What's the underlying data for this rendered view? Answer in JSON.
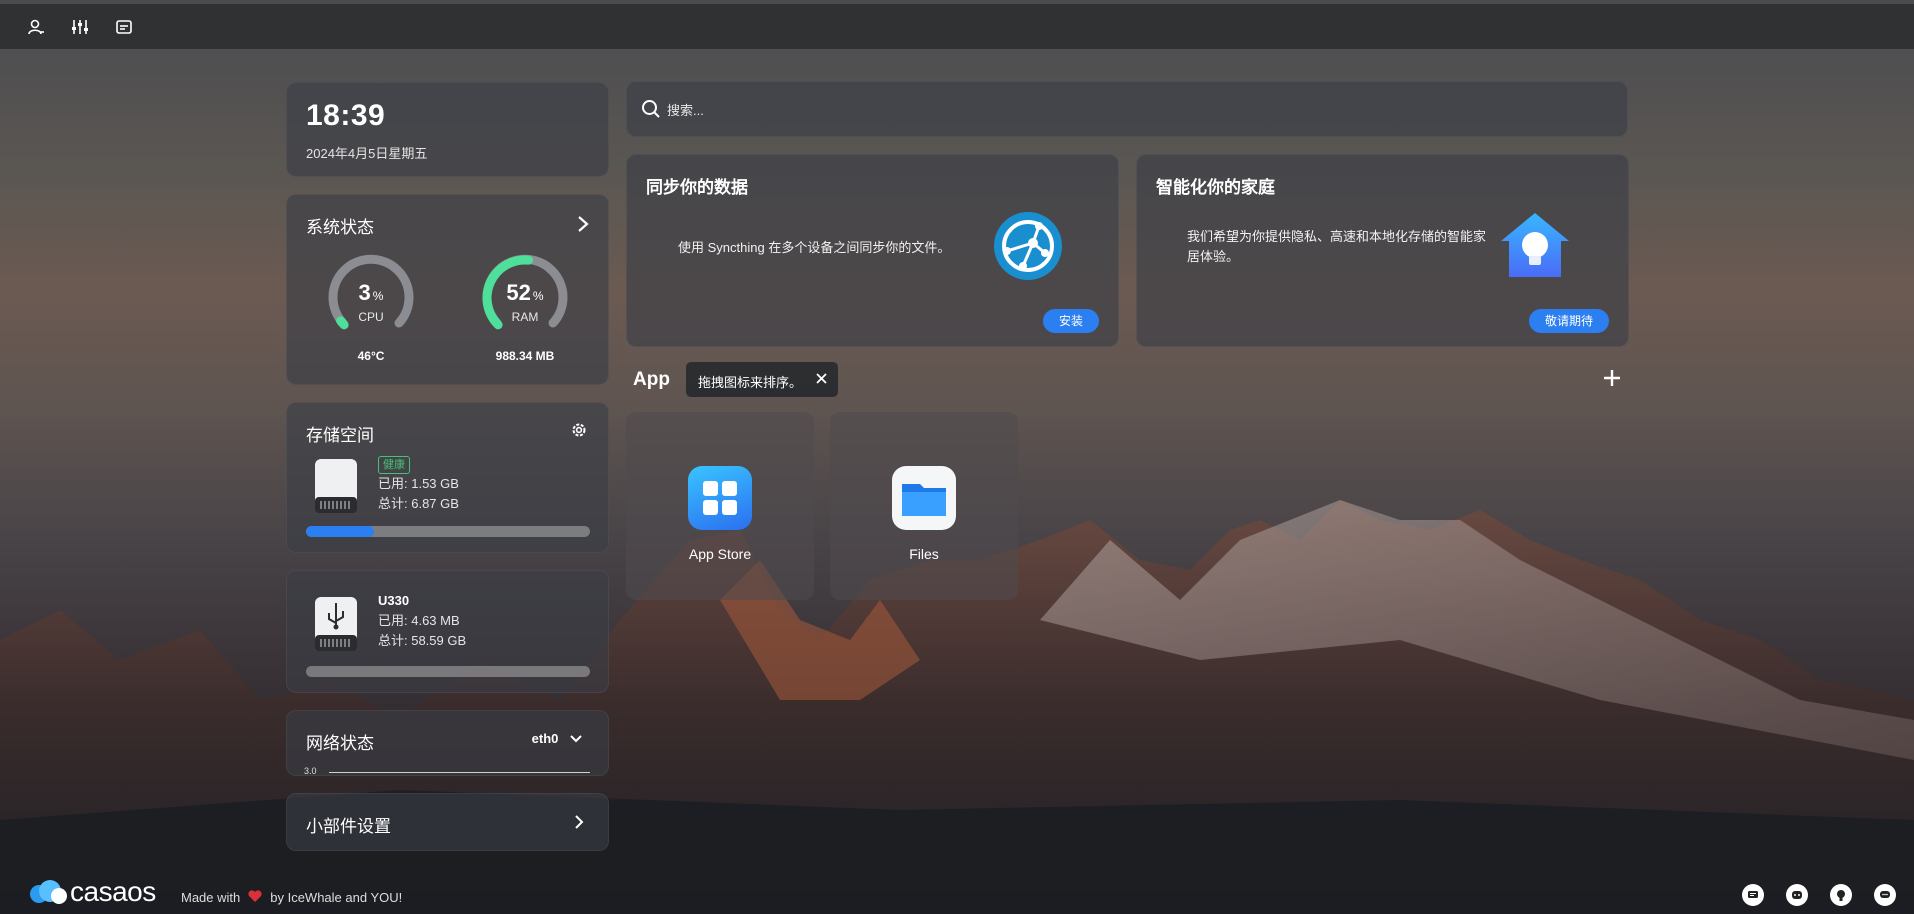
{
  "topbar": {
    "icons": [
      "user-icon",
      "sliders-icon",
      "dashboard-icon"
    ]
  },
  "clock": {
    "time": "18:39",
    "date": "2024年4月5日星期五"
  },
  "system": {
    "title": "系统状态",
    "cpu": {
      "value": "3",
      "unit": "%",
      "label": "CPU",
      "sub": "46°C",
      "percent": 3
    },
    "ram": {
      "value": "52",
      "unit": "%",
      "label": "RAM",
      "sub": "988.34 MB",
      "percent": 52
    }
  },
  "storage": {
    "title": "存储空间",
    "disks": [
      {
        "badge": "健康",
        "used": "已用: 1.53 GB",
        "total": "总计: 6.87 GB",
        "percent": 24
      },
      {
        "name": "U330",
        "used": "已用: 4.63 MB",
        "total": "总计: 58.59 GB",
        "percent": 0
      }
    ]
  },
  "network": {
    "title": "网络状态",
    "iface": "eth0",
    "scale": "3.0"
  },
  "widgets": {
    "title": "小部件设置"
  },
  "search": {
    "placeholder": "搜索..."
  },
  "features": [
    {
      "title": "同步你的数据",
      "desc": "使用 Syncthing 在多个设备之间同步你的文件。",
      "button": "安装"
    },
    {
      "title": "智能化你的家庭",
      "desc": "我们希望为你提供隐私、高速和本地化存储的智能家居体验。",
      "button": "敬请期待"
    }
  ],
  "apps": {
    "title": "App",
    "tooltip": "拖拽图标来排序。",
    "items": [
      {
        "name": "App Store"
      },
      {
        "name": "Files"
      }
    ]
  },
  "footer": {
    "logo": "casaos",
    "made_with": "Made with",
    "by": "by IceWhale and YOU!",
    "icons": [
      "chat-icon",
      "discord-icon",
      "github-icon",
      "message-icon"
    ]
  },
  "colors": {
    "accent": "#2b7ff0",
    "ram_gauge": "#4ee09a",
    "cpu_gauge": "#4ee09a",
    "heart": "#d9303a"
  }
}
